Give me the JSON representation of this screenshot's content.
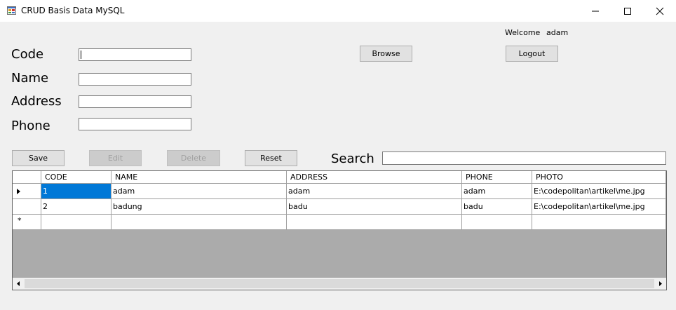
{
  "window": {
    "title": "CRUD Basis Data MySQL",
    "controls": [
      "minimize-icon",
      "maximize-icon",
      "close-icon"
    ]
  },
  "session": {
    "welcome_label": "Welcome",
    "username": "adam",
    "logout_label": "Logout"
  },
  "form": {
    "code_label": "Code",
    "name_label": "Name",
    "address_label": "Address",
    "phone_label": "Phone",
    "code_value": "",
    "name_value": "",
    "address_value": "",
    "phone_value": "",
    "browse_label": "Browse"
  },
  "actions": {
    "save_label": "Save",
    "edit_label": "Edit",
    "delete_label": "Delete",
    "reset_label": "Reset",
    "edit_enabled": false,
    "delete_enabled": false
  },
  "search": {
    "label": "Search",
    "value": ""
  },
  "grid": {
    "columns": [
      "CODE",
      "NAME",
      "ADDRESS",
      "PHONE",
      "PHOTO"
    ],
    "rows": [
      {
        "code": "1",
        "name": "adam",
        "address": "adam",
        "phone": "adam",
        "photo": "E:\\codepolitan\\artikel\\me.jpg"
      },
      {
        "code": "2",
        "name": "badung",
        "address": "badu",
        "phone": "badu",
        "photo": "E:\\codepolitan\\artikel\\me.jpg"
      }
    ],
    "selected_row": 0,
    "new_row_marker": "*"
  },
  "colors": {
    "selection": "#0078d7",
    "grid_background": "#ababab",
    "window_background": "#f0f0f0"
  }
}
